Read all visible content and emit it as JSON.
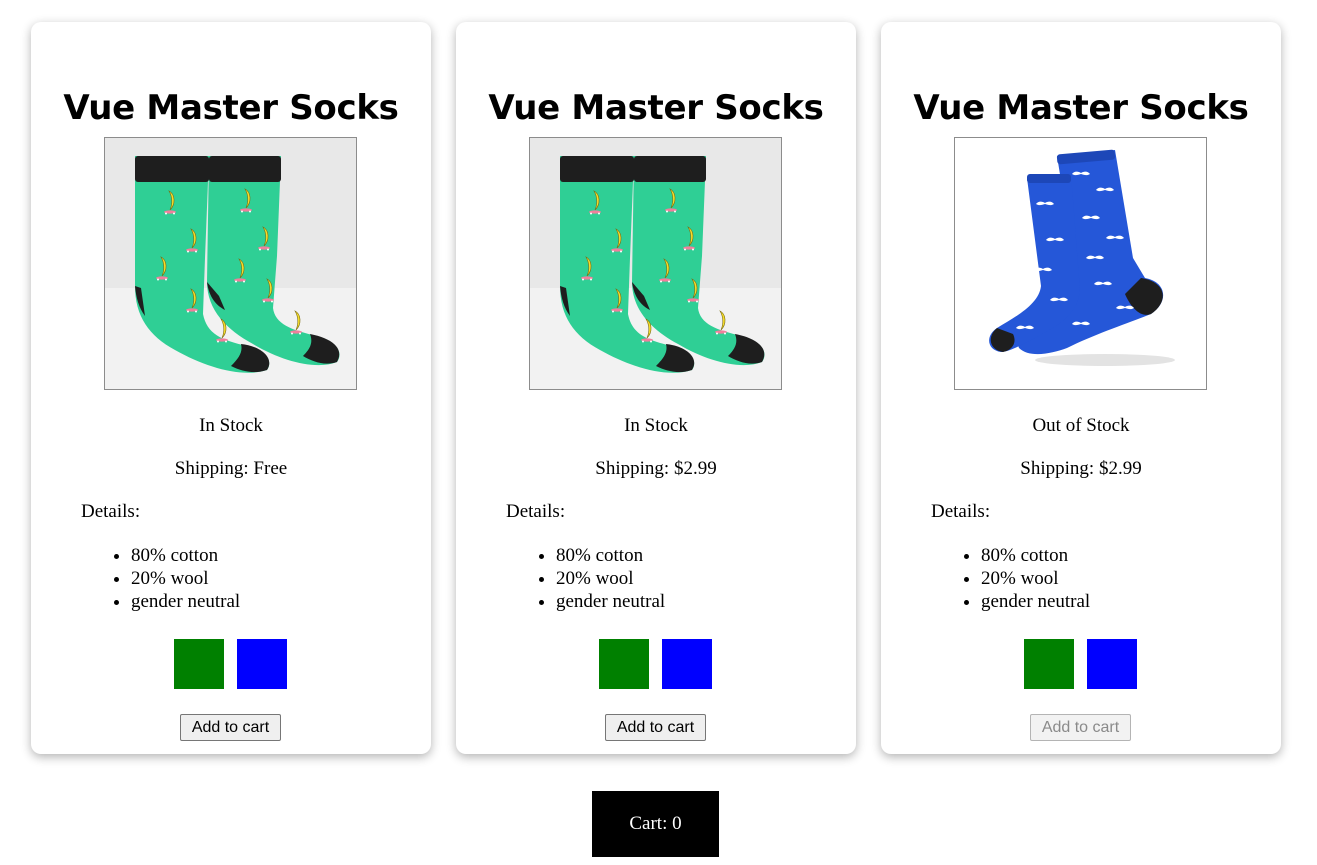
{
  "products": [
    {
      "title": "Vue Master Socks",
      "image_icon": "green-banana-socks-image",
      "stock_status": "In Stock",
      "shipping": "Shipping: Free",
      "details_label": "Details:",
      "details": [
        "80% cotton",
        "20% wool",
        "gender neutral"
      ],
      "swatches": [
        {
          "name": "green",
          "color": "#008000"
        },
        {
          "name": "blue",
          "color": "#0000ff"
        }
      ],
      "add_to_cart_label": "Add to cart",
      "add_to_cart_disabled": false
    },
    {
      "title": "Vue Master Socks",
      "image_icon": "green-banana-socks-image",
      "stock_status": "In Stock",
      "shipping": "Shipping: $2.99",
      "details_label": "Details:",
      "details": [
        "80% cotton",
        "20% wool",
        "gender neutral"
      ],
      "swatches": [
        {
          "name": "green",
          "color": "#008000"
        },
        {
          "name": "blue",
          "color": "#0000ff"
        }
      ],
      "add_to_cart_label": "Add to cart",
      "add_to_cart_disabled": false
    },
    {
      "title": "Vue Master Socks",
      "image_icon": "blue-mustache-socks-image",
      "stock_status": "Out of Stock",
      "shipping": "Shipping: $2.99",
      "details_label": "Details:",
      "details": [
        "80% cotton",
        "20% wool",
        "gender neutral"
      ],
      "swatches": [
        {
          "name": "green",
          "color": "#008000"
        },
        {
          "name": "blue",
          "color": "#0000ff"
        }
      ],
      "add_to_cart_label": "Add to cart",
      "add_to_cart_disabled": true
    }
  ],
  "cart": {
    "label": "Cart: 0"
  },
  "colors": {
    "card_background": "#ffffff",
    "cart_background": "#000000",
    "cart_text": "#ffffff",
    "sock_green": "#2fcf95",
    "sock_blue": "#2557d8",
    "sock_cuff": "#1e1e1e"
  }
}
